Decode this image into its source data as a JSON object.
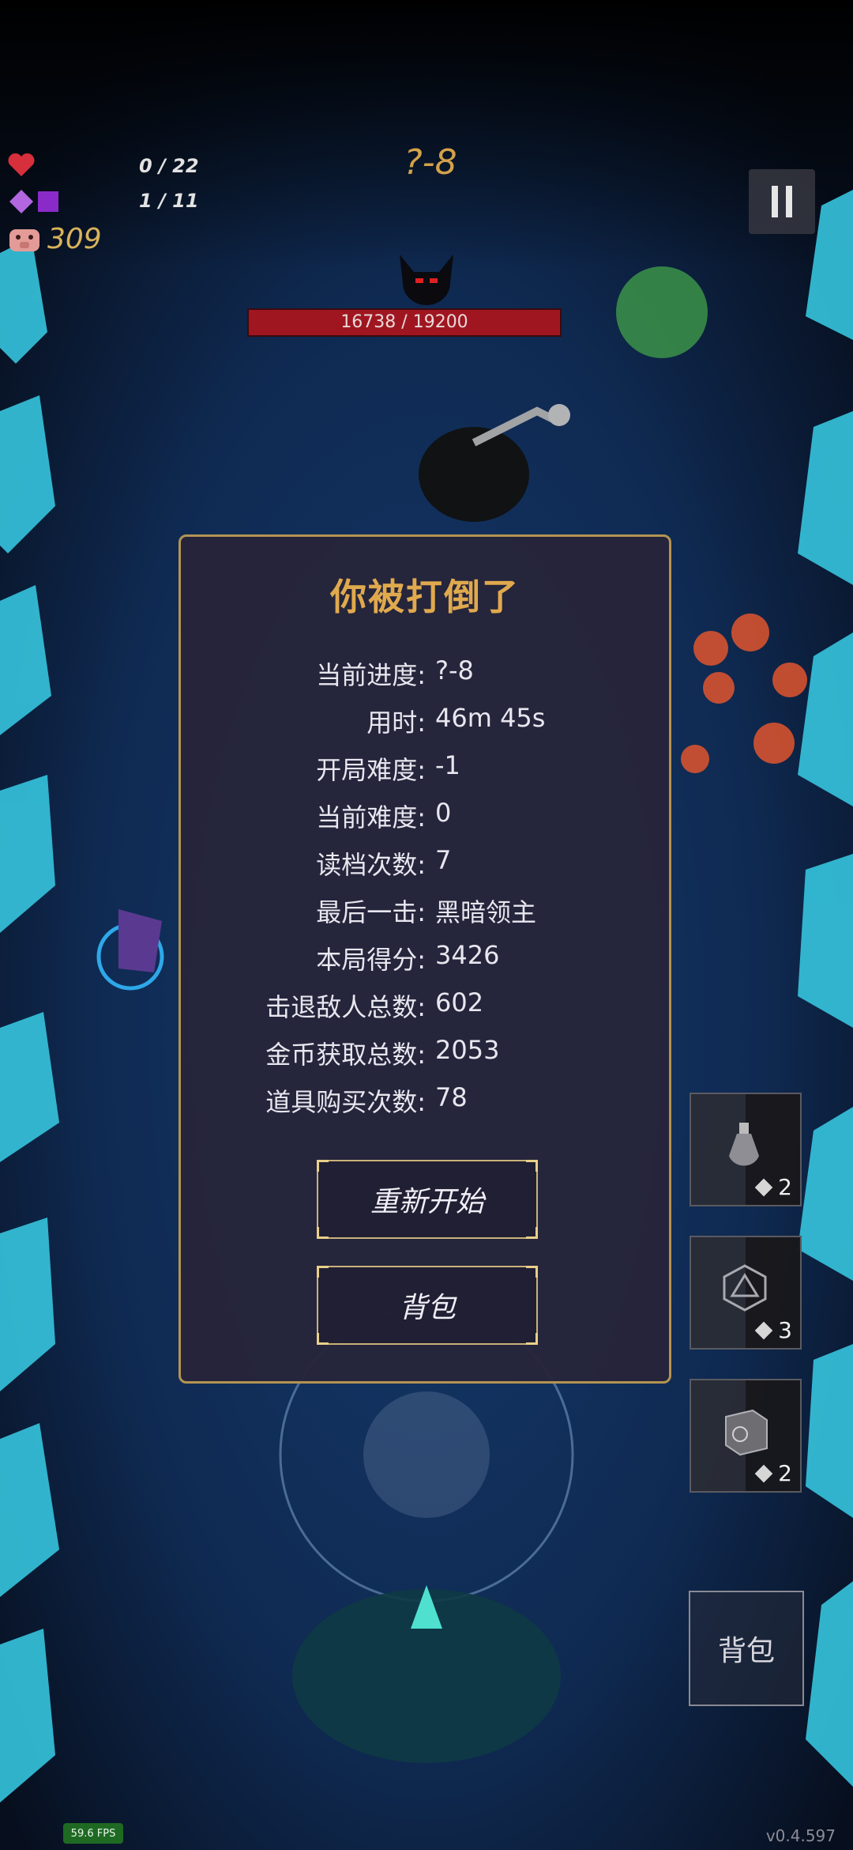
{
  "hud": {
    "health": {
      "icon": "heart-icon",
      "value": "0 / 22"
    },
    "mana": {
      "icon": "purple-diamond-icon",
      "value": "1 / 11"
    },
    "coins": {
      "icon": "pig-icon",
      "value": "309"
    },
    "level": "?-8",
    "pause_icon": "pause-icon"
  },
  "boss": {
    "icon": "boss-demon-icon",
    "hp_text": "16738 / 19200",
    "hp_fraction": 0.8718
  },
  "dialog": {
    "title": "你被打倒了",
    "stats": [
      {
        "label": "当前进度:",
        "value": "?-8"
      },
      {
        "label": "用时:",
        "value": "46m 45s"
      },
      {
        "label": "开局难度:",
        "value": "-1"
      },
      {
        "label": "当前难度:",
        "value": "0"
      },
      {
        "label": "读档次数:",
        "value": "7"
      },
      {
        "label": "最后一击:",
        "value": "黑暗领主"
      },
      {
        "label": "本局得分:",
        "value": "3426"
      },
      {
        "label": "击退敌人总数:",
        "value": "602"
      },
      {
        "label": "金币获取总数:",
        "value": "2053"
      },
      {
        "label": "道具购买次数:",
        "value": "78"
      }
    ],
    "restart_label": "重新开始",
    "bag_label": "背包"
  },
  "items": [
    {
      "icon": "potion-icon",
      "count": "2"
    },
    {
      "icon": "dice-icon",
      "count": "3"
    },
    {
      "icon": "rune-cube-icon",
      "count": "2"
    }
  ],
  "bag_button_label": "背包",
  "fps": "59.6 FPS",
  "version": "v0.4.597",
  "colors": {
    "accent": "#d4a24a",
    "dialog_bg": "#26243a",
    "boss_hp": "#a01620"
  }
}
